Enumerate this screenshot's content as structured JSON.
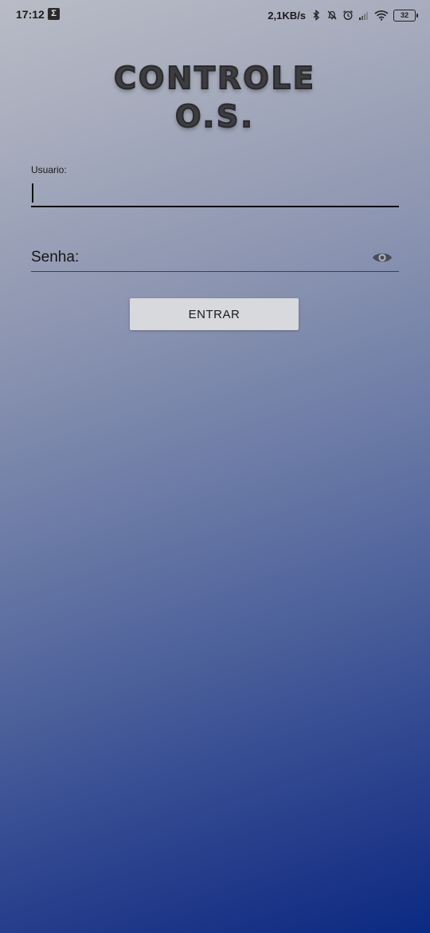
{
  "status_bar": {
    "time": "17:12",
    "sigma_symbol": "Σ",
    "net_speed": "2,1KB/s",
    "battery_level": "32",
    "icons": [
      "bluetooth-icon",
      "mute-icon",
      "alarm-icon",
      "signal-icon",
      "wifi-icon",
      "battery-icon"
    ]
  },
  "app": {
    "title_line1": "CONTROLE",
    "title_line2": "O.S."
  },
  "form": {
    "username_label": "Usuario:",
    "username_value": "",
    "password_placeholder": "Senha:",
    "password_value": "",
    "submit_label": "ENTRAR"
  },
  "colors": {
    "background_top": "#b9bcc6",
    "background_bottom": "#0b2a84",
    "button_bg": "#d8d9dc",
    "title_color": "#3d3d40"
  }
}
